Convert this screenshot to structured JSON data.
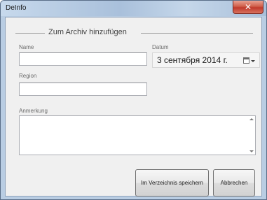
{
  "window": {
    "title": "DeInfo",
    "close_glyph": "✕"
  },
  "form": {
    "group_title": "Zum Archiv hinzufügen",
    "name_label": "Name",
    "name_value": "",
    "date_label": "Datum",
    "date_value": "3 сентября 2014 г.",
    "region_label": "Region",
    "region_value": "",
    "note_label": "Anmerkung",
    "note_value": ""
  },
  "buttons": {
    "save_label": "Im Verzeichnis speichern",
    "cancel_label": "Abbrechen"
  },
  "icons": {
    "close": "close-icon",
    "calendar": "calendar-icon",
    "dropdown": "chevron-down-icon",
    "scroll_up": "scroll-up-icon",
    "scroll_down": "scroll-down-icon"
  },
  "colors": {
    "title_bar": "#b9cde3",
    "close_button": "#c0392b",
    "client_background": "#f0f0f0"
  }
}
